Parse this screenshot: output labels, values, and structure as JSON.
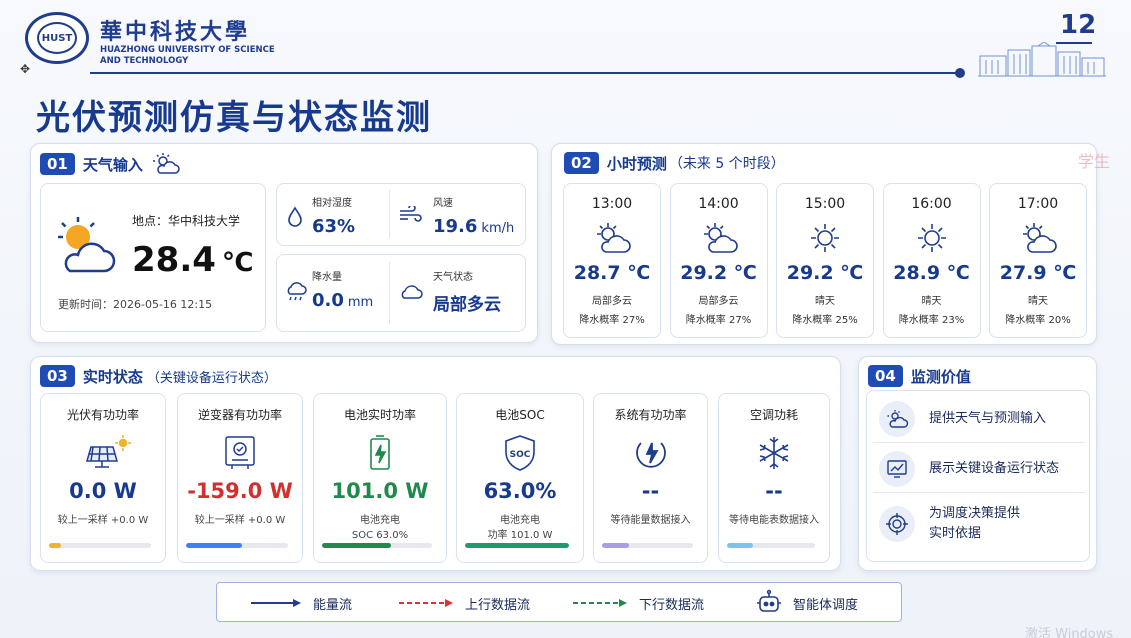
{
  "header": {
    "seal_text": "HUST",
    "university_cn": "華中科技大學",
    "university_en_line1": "HUAZHONG UNIVERSITY OF SCIENCE",
    "university_en_line2": "AND TECHNOLOGY",
    "page_number": "12"
  },
  "title": "光伏预测仿真与状态监测",
  "weather_input": {
    "num": "01",
    "title": "天气输入",
    "location_label": "地点：华中科技大学",
    "temperature": "28.4",
    "temp_unit": "℃",
    "updated": "更新时间：2026-05-16 12:15",
    "humidity_label": "相对湿度",
    "humidity": "63%",
    "wind_label": "风速",
    "wind_value": "19.6",
    "wind_unit": "km/h",
    "rain_label": "降水量",
    "rain_value": "0.0",
    "rain_unit": "mm",
    "condition_label": "天气状态",
    "condition": "局部多云"
  },
  "hourly": {
    "num": "02",
    "title": "小时预测",
    "subtitle": "（未来 5 个时段）",
    "items": [
      {
        "time": "13:00",
        "temp": "28.7 ℃",
        "desc": "局部多云",
        "rain": "降水概率 27%",
        "icon": "partly-cloudy"
      },
      {
        "time": "14:00",
        "temp": "29.2 ℃",
        "desc": "局部多云",
        "rain": "降水概率 27%",
        "icon": "partly-cloudy"
      },
      {
        "time": "15:00",
        "temp": "29.2 ℃",
        "desc": "晴天",
        "rain": "降水概率 25%",
        "icon": "sun"
      },
      {
        "time": "16:00",
        "temp": "28.9 ℃",
        "desc": "晴天",
        "rain": "降水概率 23%",
        "icon": "sun"
      },
      {
        "time": "17:00",
        "temp": "27.9 ℃",
        "desc": "晴天",
        "rain": "降水概率 20%",
        "icon": "partly-cloudy"
      }
    ]
  },
  "realtime": {
    "num": "03",
    "title": "实时状态",
    "subtitle": "（关键设备运行状态）",
    "cards": [
      {
        "name": "光伏有功功率",
        "value": "0.0 W",
        "note1": "较上一采样 +0.0 W",
        "note2": "",
        "value_color": "#173a8f",
        "bar_color": "#f0b429",
        "level": 0.12
      },
      {
        "name": "逆变器有功功率",
        "value": "-159.0 W",
        "note1": "较上一采样 +0.0 W",
        "note2": "",
        "value_color": "#d23030",
        "bar_color": "#3b82f6",
        "level": 0.55
      },
      {
        "name": "电池实时功率",
        "value": "101.0 W",
        "note1": "电池充电",
        "note2": "SOC 63.0%",
        "value_color": "#1f8a4c",
        "bar_color": "#1f8a4c",
        "level": 0.63
      },
      {
        "name": "电池SOC",
        "value": "63.0%",
        "note1": "电池充电",
        "note2": "功率 101.0 W",
        "value_color": "#173a8f",
        "bar_color": "#1f9a6a",
        "level": 1.0
      },
      {
        "name": "系统有功功率",
        "value": "--",
        "note1": "等待能量数据接入",
        "note2": "",
        "value_color": "#173a8f",
        "bar_color": "#a99de8",
        "level": 0.3
      },
      {
        "name": "空调功耗",
        "value": "--",
        "note1": "等待电能表数据接入",
        "note2": "",
        "value_color": "#173a8f",
        "bar_color": "#7cc4ee",
        "level": 0.3
      }
    ]
  },
  "value": {
    "num": "04",
    "title": "监测价值",
    "items": [
      {
        "line1": "提供天气与预测输入",
        "line2": ""
      },
      {
        "line1": "展示关键设备运行状态",
        "line2": ""
      },
      {
        "line1": "为调度决策提供",
        "line2": "实时依据"
      }
    ]
  },
  "legend": {
    "energy": "能量流",
    "up": "上行数据流",
    "down": "下行数据流",
    "agent": "智能体调度"
  },
  "watermark": "学生",
  "os_watermark": "激活 Windows",
  "colors": {
    "brand": "#1f3c8f",
    "accent": "#1f4bb5",
    "negative": "#d23030",
    "positive": "#1f8a4c"
  }
}
